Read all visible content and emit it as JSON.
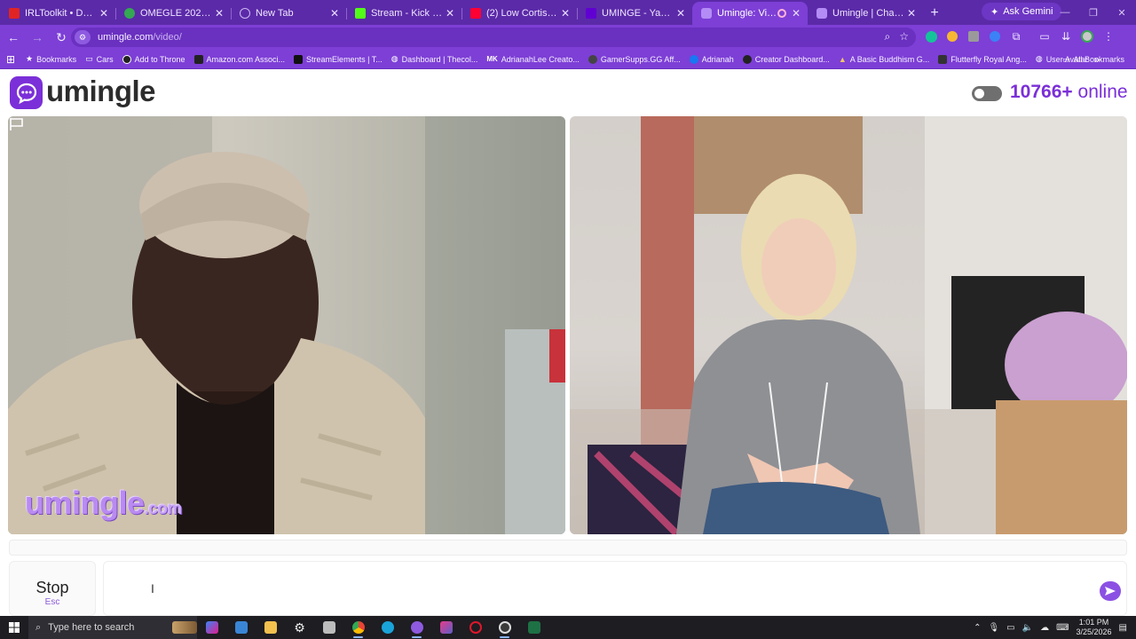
{
  "browser": {
    "tabs": [
      {
        "title": "IRLToolkit • Dashboard",
        "favicon_color": "#e02424",
        "active": false
      },
      {
        "title": "OMEGLE 2026 - Google",
        "favicon_color": "#34a853",
        "active": false
      },
      {
        "title": "New Tab",
        "favicon_color": "",
        "active": false
      },
      {
        "title": "Stream - Kick Dashboard",
        "favicon_color": "#53fc18",
        "active": false
      },
      {
        "title": "(2) Low Cortisol Playlist",
        "favicon_color": "#ff0033",
        "active": false
      },
      {
        "title": "UMINGE - Yahoo Search",
        "favicon_color": "#6001d2",
        "active": false
      },
      {
        "title": "Umingle: Video Ch",
        "favicon_color": "#9b6cf0",
        "active": true
      },
      {
        "title": "Umingle | Chat with St",
        "favicon_color": "#9b6cf0",
        "active": false
      }
    ],
    "ask_gemini_label": "Ask Gemini",
    "url_host": "umingle.com",
    "url_path": "/video/",
    "bookmarks": [
      {
        "label": "Bookmarks",
        "icon": "star-icon",
        "color": "#ffffff"
      },
      {
        "label": "Cars",
        "icon": "folder-icon",
        "color": "#ffffff"
      },
      {
        "label": "Add to Throne",
        "icon": "throne-icon",
        "color": "#222222"
      },
      {
        "label": "Amazon.com Associ...",
        "icon": "amazon-icon",
        "color": "#222222"
      },
      {
        "label": "StreamElements | T...",
        "icon": "streamelements-icon",
        "color": "#111111"
      },
      {
        "label": "Dashboard | Thecol...",
        "icon": "globe-icon",
        "color": "#ffffff"
      },
      {
        "label": "AdrianahLee Creato...",
        "icon": "mk-icon",
        "color": "#333333"
      },
      {
        "label": "GamerSupps.GG Aff...",
        "icon": "gg-icon",
        "color": "#444444"
      },
      {
        "label": "Adrianah",
        "icon": "facebook-icon",
        "color": "#1877f2"
      },
      {
        "label": "Creator Dashboard...",
        "icon": "creator-icon",
        "color": "#222222"
      },
      {
        "label": "A Basic Buddhism G...",
        "icon": "buddhism-icon",
        "color": "#c58b2a"
      },
      {
        "label": "Flutterfly Royal Ang...",
        "icon": "flutterfly-icon",
        "color": "#333333"
      },
      {
        "label": "User Avatar",
        "icon": "globe-icon",
        "color": "#ffffff"
      }
    ],
    "all_bookmarks_label": "All Bookmarks"
  },
  "page": {
    "logo_text": "umingle",
    "online_count": "10766+",
    "online_label": "online",
    "watermark_main": "umingle",
    "watermark_suffix": ".com",
    "stop_label": "Stop",
    "stop_key": "Esc",
    "brand_color": "#7b2fd8"
  },
  "taskbar": {
    "search_placeholder": "Type here to search",
    "time": "1:01 PM",
    "date": "3/25/2026"
  }
}
